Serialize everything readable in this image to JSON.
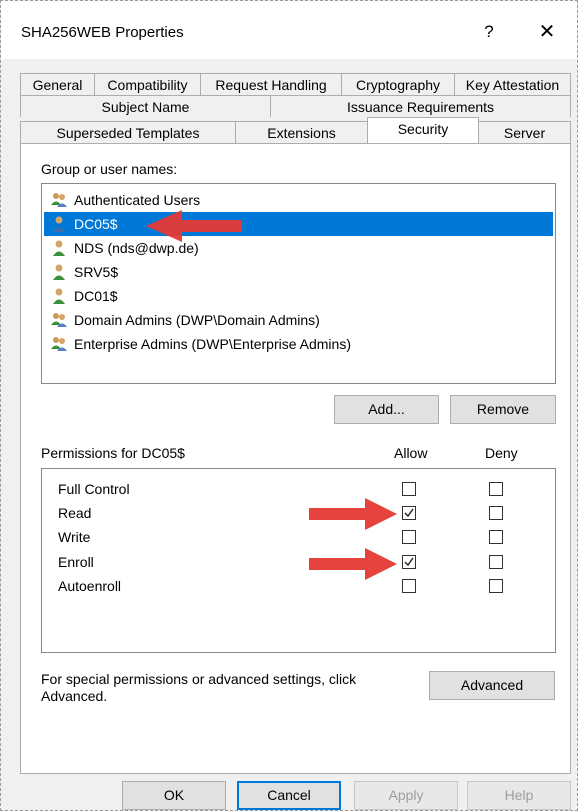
{
  "window": {
    "title": "SHA256WEB Properties",
    "help_glyph": "?",
    "close_glyph": "✕"
  },
  "tabs": {
    "row1": [
      "General",
      "Compatibility",
      "Request Handling",
      "Cryptography",
      "Key Attestation"
    ],
    "row2": [
      "Subject Name",
      "Issuance Requirements"
    ],
    "row3": [
      "Superseded Templates",
      "Extensions",
      "Security",
      "Server"
    ],
    "active": "Security"
  },
  "security": {
    "group_label": "Group or user names:",
    "users": [
      {
        "name": "Authenticated Users",
        "icon": "group-icon",
        "selected": false
      },
      {
        "name": "DC05$",
        "icon": "user-icon",
        "selected": true
      },
      {
        "name": "NDS (nds@dwp.de)",
        "icon": "user-icon",
        "selected": false
      },
      {
        "name": "SRV5$",
        "icon": "user-icon",
        "selected": false
      },
      {
        "name": "DC01$",
        "icon": "user-icon",
        "selected": false
      },
      {
        "name": "Domain Admins (DWP\\Domain Admins)",
        "icon": "group-icon",
        "selected": false
      },
      {
        "name": "Enterprise Admins (DWP\\Enterprise Admins)",
        "icon": "group-icon",
        "selected": false
      }
    ],
    "add_label": "Add...",
    "remove_label": "Remove",
    "permissions_label": "Permissions for DC05$",
    "allow_header": "Allow",
    "deny_header": "Deny",
    "permissions": [
      {
        "name": "Full Control",
        "allow": false,
        "deny": false
      },
      {
        "name": "Read",
        "allow": true,
        "deny": false
      },
      {
        "name": "Write",
        "allow": false,
        "deny": false
      },
      {
        "name": "Enroll",
        "allow": true,
        "deny": false
      },
      {
        "name": "Autoenroll",
        "allow": false,
        "deny": false
      }
    ],
    "advanced_text": "For special permissions or advanced settings, click Advanced.",
    "advanced_label": "Advanced"
  },
  "footer": {
    "ok": "OK",
    "cancel": "Cancel",
    "apply": "Apply",
    "help": "Help"
  },
  "colors": {
    "selection": "#0078d7",
    "arrow": "#e53935",
    "dialog_bg": "#f0f0f0"
  }
}
